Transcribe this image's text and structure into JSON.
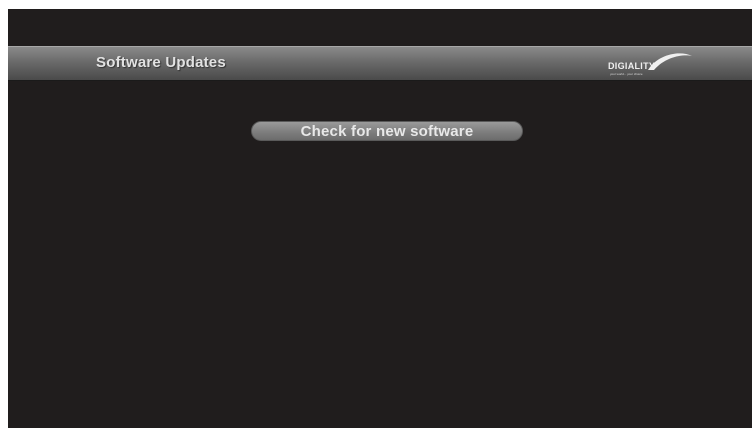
{
  "header": {
    "title": "Software Updates"
  },
  "logo": {
    "brand": "DIGIALITY",
    "tagline": "your world... your choice"
  },
  "main": {
    "check_button_label": "Check for new software"
  },
  "colors": {
    "background": "#201d1d",
    "header_bar": "#6a6a6a",
    "button": "#7e7e7e",
    "text": "#e2e2e2"
  }
}
